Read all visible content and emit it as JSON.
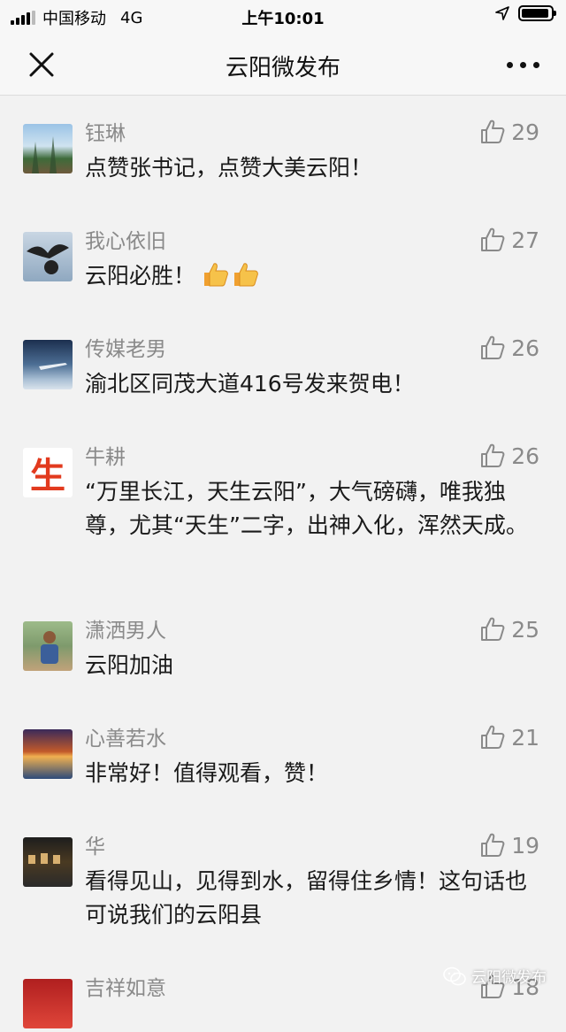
{
  "status_bar": {
    "carrier": "中国移动",
    "network": "4G",
    "time": "上午10:01"
  },
  "nav": {
    "title": "云阳微发布"
  },
  "comments": [
    {
      "name": "钰琳",
      "text": "点赞张书记，点赞大美云阳！",
      "likes": "29"
    },
    {
      "name": "我心依旧",
      "text": "云阳必胜！",
      "likes": "27",
      "emoji": [
        "thumbs-up-emoji",
        "thumbs-up-emoji"
      ]
    },
    {
      "name": "传媒老男",
      "text": "渝北区同茂大道416号发来贺电！",
      "likes": "26"
    },
    {
      "name": "牛耕",
      "text": "“万里长江，天生云阳”，大气磅礴，唯我独尊，尤其“天生”二字，出神入化，浑然天成。",
      "likes": "26",
      "avatar_glyph": "生"
    },
    {
      "name": "潇洒男人",
      "text": "云阳加油",
      "likes": "25"
    },
    {
      "name": "心善若水",
      "text": "非常好！值得观看，赞！",
      "likes": "21"
    },
    {
      "name": "华",
      "text": "看得见山，见得到水，留得住乡情！这句话也可说我们的云阳县",
      "likes": "19"
    },
    {
      "name": "吉祥如意",
      "text": "",
      "likes": "18"
    }
  ],
  "watermark": {
    "text": "云阳微发布"
  },
  "colors": {
    "background": "#f2f2f2",
    "name_gray": "#8a8a8a",
    "text": "#1a1a1a"
  }
}
